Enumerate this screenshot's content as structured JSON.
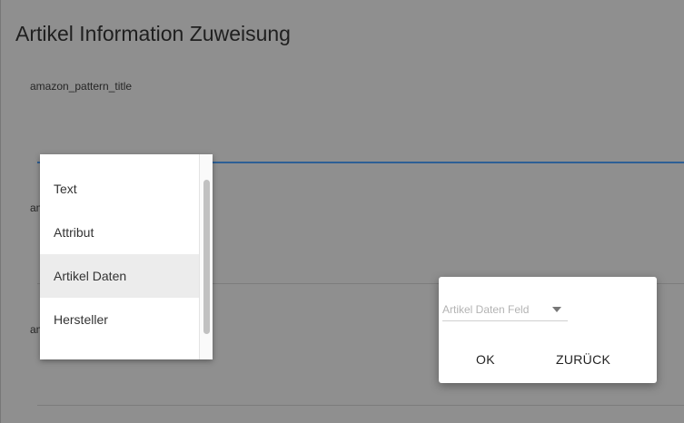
{
  "page": {
    "title": "Artikel Information Zuweisung",
    "fields": [
      {
        "label": "amazon_pattern_title"
      },
      {
        "label": "am"
      },
      {
        "label": "am"
      }
    ]
  },
  "dropdown": {
    "items": [
      {
        "label": "Text",
        "selected": false
      },
      {
        "label": "Attribut",
        "selected": false
      },
      {
        "label": "Artikel Daten",
        "selected": true
      },
      {
        "label": "Hersteller",
        "selected": false
      }
    ]
  },
  "dialog": {
    "select_placeholder": "Artikel Daten Feld",
    "ok_label": "OK",
    "back_label": "ZURÜCK"
  },
  "colors": {
    "overlay_background": "#8f8f8f",
    "focus_line": "#2d5f95",
    "selected_item_bg": "#ececec"
  }
}
